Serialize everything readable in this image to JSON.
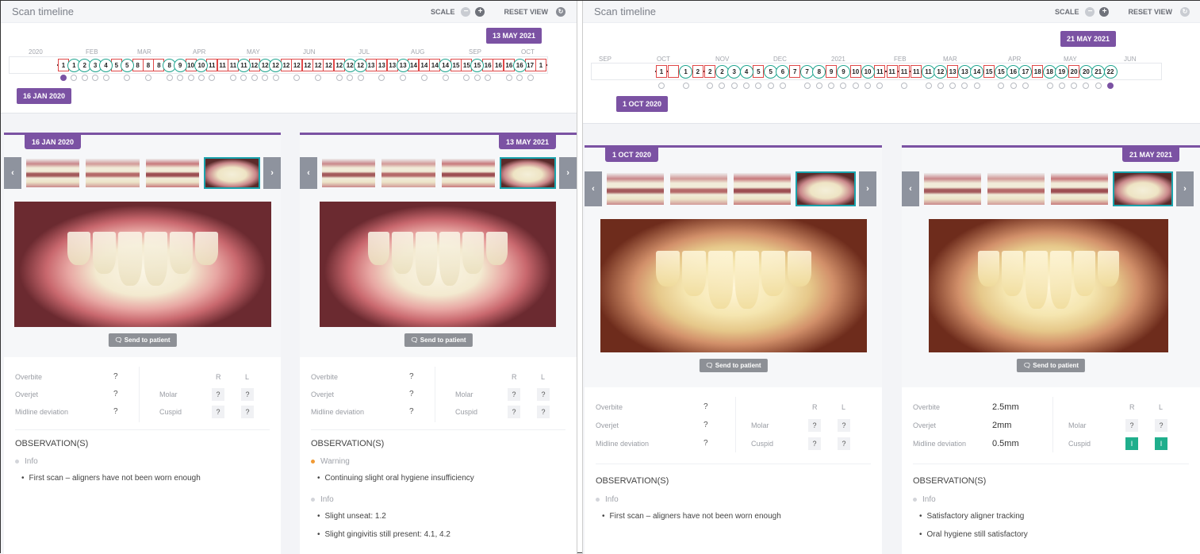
{
  "left": {
    "timeline": {
      "title": "Scan timeline",
      "scale_label": "SCALE",
      "reset_label": "RESET VIEW",
      "months": [
        "2020",
        "FEB",
        "MAR",
        "APR",
        "MAY",
        "JUN",
        "JUL",
        "AUG",
        "SEP",
        "OCT"
      ],
      "markers": [
        {
          "t": "sq",
          "l": "1"
        },
        {
          "t": "ci",
          "l": "1"
        },
        {
          "t": "ci",
          "l": "2"
        },
        {
          "t": "ci",
          "l": "3"
        },
        {
          "t": "ci",
          "l": "4"
        },
        {
          "t": "sq",
          "l": "5"
        },
        {
          "t": "ci",
          "l": "5"
        },
        {
          "t": "sq",
          "l": "8"
        },
        {
          "t": "sq",
          "l": "8"
        },
        {
          "t": "sq",
          "l": "8"
        },
        {
          "t": "ci",
          "l": "8"
        },
        {
          "t": "ci",
          "l": "9"
        },
        {
          "t": "sq",
          "l": "10"
        },
        {
          "t": "ci",
          "l": "10"
        },
        {
          "t": "sq",
          "l": "11"
        },
        {
          "t": "sq",
          "l": "11"
        },
        {
          "t": "sq",
          "l": "11"
        },
        {
          "t": "ci",
          "l": "11"
        },
        {
          "t": "sq",
          "l": "12"
        },
        {
          "t": "ci",
          "l": "12"
        },
        {
          "t": "ci",
          "l": "12"
        },
        {
          "t": "sq",
          "l": "12"
        },
        {
          "t": "sq",
          "l": "12"
        },
        {
          "t": "sq",
          "l": "12"
        },
        {
          "t": "sq",
          "l": "12"
        },
        {
          "t": "sq",
          "l": "12"
        },
        {
          "t": "sq",
          "l": "12"
        },
        {
          "t": "ci",
          "l": "12"
        },
        {
          "t": "ci",
          "l": "12"
        },
        {
          "t": "sq",
          "l": "13"
        },
        {
          "t": "sq",
          "l": "13"
        },
        {
          "t": "sq",
          "l": "13"
        },
        {
          "t": "ci",
          "l": "13"
        },
        {
          "t": "sq",
          "l": "14"
        },
        {
          "t": "sq",
          "l": "14"
        },
        {
          "t": "sq",
          "l": "14"
        },
        {
          "t": "ci",
          "l": "14"
        },
        {
          "t": "sq",
          "l": "15"
        },
        {
          "t": "sq",
          "l": "15"
        },
        {
          "t": "ci",
          "l": "15"
        },
        {
          "t": "sq",
          "l": "16"
        },
        {
          "t": "sq",
          "l": "16"
        },
        {
          "t": "sq",
          "l": "16"
        },
        {
          "t": "ci",
          "l": "16"
        },
        {
          "t": "sq",
          "l": "17"
        },
        {
          "t": "sq",
          "l": "1"
        }
      ],
      "start_flag": "16 JAN 2020",
      "end_flag": "13 MAY 2021"
    },
    "panels": [
      {
        "date": "16 JAN 2020",
        "send_label": "Send to patient",
        "measures": {
          "overbite_label": "Overbite",
          "overbite": "?",
          "overjet_label": "Overjet",
          "overjet": "?",
          "midline_label": "Midline deviation",
          "midline": "?",
          "r_label": "R",
          "l_label": "L",
          "molar_label": "Molar",
          "molar_r": "?",
          "molar_l": "?",
          "cuspid_label": "Cuspid",
          "cuspid_r": "?",
          "cuspid_l": "?"
        },
        "obs_title": "OBSERVATION(S)",
        "observations": [
          {
            "category": "Info",
            "level": "info",
            "items": [
              "First scan – aligners have not been worn enough"
            ]
          }
        ]
      },
      {
        "date": "13 MAY 2021",
        "send_label": "Send to patient",
        "measures": {
          "overbite_label": "Overbite",
          "overbite": "?",
          "overjet_label": "Overjet",
          "overjet": "?",
          "midline_label": "Midline deviation",
          "midline": "?",
          "r_label": "R",
          "l_label": "L",
          "molar_label": "Molar",
          "molar_r": "?",
          "molar_l": "?",
          "cuspid_label": "Cuspid",
          "cuspid_r": "?",
          "cuspid_l": "?"
        },
        "obs_title": "OBSERVATION(S)",
        "observations": [
          {
            "category": "Warning",
            "level": "warning",
            "items": [
              "Continuing slight oral hygiene insufficiency"
            ]
          },
          {
            "category": "Info",
            "level": "info",
            "items": [
              "Slight unseat: 1.2",
              "Slight gingivitis still present: 4.1, 4.2"
            ]
          }
        ]
      }
    ]
  },
  "right": {
    "timeline": {
      "title": "Scan timeline",
      "scale_label": "SCALE",
      "reset_label": "RESET VIEW",
      "months": [
        "SEP",
        "OCT",
        "NOV",
        "DEC",
        "2021",
        "FEB",
        "MAR",
        "APR",
        "MAY",
        "JUN"
      ],
      "markers": [
        {
          "t": "sq",
          "l": "1"
        },
        {
          "t": "sq",
          "l": ""
        },
        {
          "t": "ci",
          "l": "1"
        },
        {
          "t": "sq",
          "l": "2"
        },
        {
          "t": "sq",
          "l": "2"
        },
        {
          "t": "ci",
          "l": "2"
        },
        {
          "t": "ci",
          "l": "3"
        },
        {
          "t": "ci",
          "l": "4"
        },
        {
          "t": "sq",
          "l": "5"
        },
        {
          "t": "ci",
          "l": "5"
        },
        {
          "t": "ci",
          "l": "6"
        },
        {
          "t": "sq",
          "l": "7"
        },
        {
          "t": "ci",
          "l": "7"
        },
        {
          "t": "ci",
          "l": "8"
        },
        {
          "t": "sq",
          "l": "9"
        },
        {
          "t": "ci",
          "l": "9"
        },
        {
          "t": "sq",
          "l": "10"
        },
        {
          "t": "ci",
          "l": "10"
        },
        {
          "t": "sq",
          "l": "11"
        },
        {
          "t": "sq",
          "l": "11"
        },
        {
          "t": "sq",
          "l": "11"
        },
        {
          "t": "sq",
          "l": "11"
        },
        {
          "t": "ci",
          "l": "11"
        },
        {
          "t": "ci",
          "l": "12"
        },
        {
          "t": "sq",
          "l": "13"
        },
        {
          "t": "ci",
          "l": "13"
        },
        {
          "t": "ci",
          "l": "14"
        },
        {
          "t": "sq",
          "l": "15"
        },
        {
          "t": "ci",
          "l": "15"
        },
        {
          "t": "ci",
          "l": "16"
        },
        {
          "t": "ci",
          "l": "17"
        },
        {
          "t": "sq",
          "l": "18"
        },
        {
          "t": "ci",
          "l": "18"
        },
        {
          "t": "ci",
          "l": "19"
        },
        {
          "t": "sq",
          "l": "20"
        },
        {
          "t": "ci",
          "l": "20"
        },
        {
          "t": "ci",
          "l": "21"
        },
        {
          "t": "ci",
          "l": "22"
        }
      ],
      "start_flag": "1 OCT 2020",
      "end_flag": "21 MAY 2021"
    },
    "panels": [
      {
        "date": "1 OCT 2020",
        "send_label": "Send to patient",
        "measures": {
          "overbite_label": "Overbite",
          "overbite": "?",
          "overjet_label": "Overjet",
          "overjet": "?",
          "midline_label": "Midline deviation",
          "midline": "?",
          "r_label": "R",
          "l_label": "L",
          "molar_label": "Molar",
          "molar_r": "?",
          "molar_l": "?",
          "cuspid_label": "Cuspid",
          "cuspid_r": "?",
          "cuspid_l": "?"
        },
        "obs_title": "OBSERVATION(S)",
        "observations": [
          {
            "category": "Info",
            "level": "info",
            "items": [
              "First scan – aligners have not been worn enough"
            ]
          }
        ]
      },
      {
        "date": "21 MAY 2021",
        "send_label": "Send to patient",
        "measures": {
          "overbite_label": "Overbite",
          "overbite": "2.5mm",
          "overjet_label": "Overjet",
          "overjet": "2mm",
          "midline_label": "Midline deviation",
          "midline": "0.5mm",
          "r_label": "R",
          "l_label": "L",
          "molar_label": "Molar",
          "molar_r": "?",
          "molar_l": "?",
          "cuspid_label": "Cuspid",
          "cuspid_r": "I",
          "cuspid_l": "I"
        },
        "obs_title": "OBSERVATION(S)",
        "observations": [
          {
            "category": "Info",
            "level": "info",
            "items": [
              "Satisfactory aligner tracking",
              "Oral hygiene still satisfactory"
            ]
          }
        ]
      }
    ]
  }
}
